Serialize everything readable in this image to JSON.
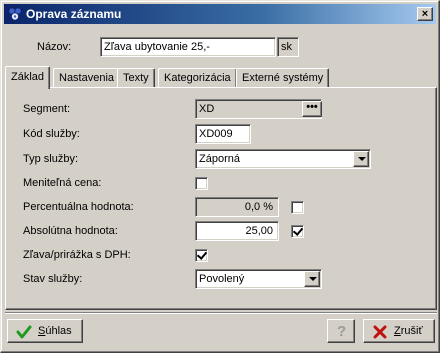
{
  "window": {
    "title": "Oprava záznamu",
    "close_glyph": "×"
  },
  "header": {
    "nazov_label": "Názov:",
    "nazov_value": "Zľava ubytovanie 25,-",
    "lang_code": "sk"
  },
  "tabs": [
    {
      "label": "Základ",
      "active": true
    },
    {
      "label": "Nastavenia",
      "active": false
    },
    {
      "label": "Texty",
      "active": false
    },
    {
      "label": "Kategorizácia",
      "active": false
    },
    {
      "label": "Externé systémy",
      "active": false
    }
  ],
  "form": {
    "segment": {
      "label": "Segment:",
      "value": "XD",
      "button_glyph": "•••"
    },
    "kod_sluzby": {
      "label": "Kód služby:",
      "value": "XD009"
    },
    "typ_sluzby": {
      "label": "Typ služby:",
      "value": "Záporná"
    },
    "menitelna_cena": {
      "label": "Meniteľná cena:",
      "checked": false
    },
    "percentualna_hodnota": {
      "label": "Percentuálna hodnota:",
      "value": "0,0 %",
      "checked": false
    },
    "absolutna_hodnota": {
      "label": "Absolútna hodnota:",
      "value": "25,00",
      "checked": true
    },
    "zlava_dph": {
      "label": "Zľava/prirážka s DPH:",
      "checked": true
    },
    "stav_sluzby": {
      "label": "Stav služby:",
      "value": "Povolený"
    }
  },
  "buttons": {
    "suhlas": {
      "label": "Súhlas",
      "accel": "S",
      "rest": "úhlas"
    },
    "help": {
      "glyph": "?"
    },
    "zrusit": {
      "label": "Zrušiť",
      "accel": "Z",
      "rest": "rušiť"
    }
  },
  "colors": {
    "titlebar_start": "#0a246a",
    "titlebar_end": "#a6caf0",
    "face": "#d4d0c8",
    "ok_green": "#1f9a1f",
    "cancel_red": "#c01010"
  },
  "icons": {
    "app": "app-icon",
    "ok": "checkmark-icon",
    "help": "help-icon",
    "cancel": "cross-icon"
  }
}
